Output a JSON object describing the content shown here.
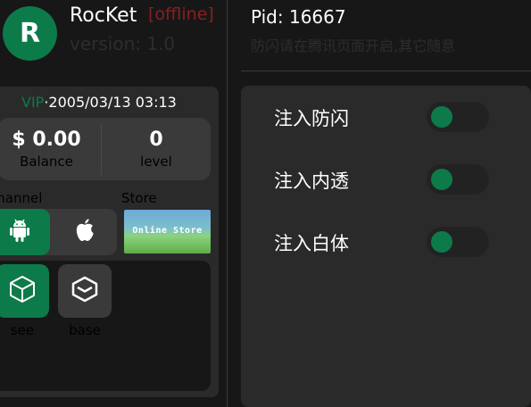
{
  "app": {
    "avatar_letter": "R",
    "name": "RocKet",
    "status": "[offline]",
    "version": "version: 1.0"
  },
  "account": {
    "vip_label": "VIP",
    "separator": "·",
    "date": "2005/03/13  03:13",
    "balance_value": "$ 0.00",
    "balance_label": "Balance",
    "level_value": "0",
    "level_label": "level"
  },
  "channel": {
    "label": "channel",
    "options": [
      {
        "name": "android",
        "icon": "android-icon",
        "active": true
      },
      {
        "name": "apple",
        "icon": "apple-icon",
        "active": false
      }
    ]
  },
  "store": {
    "label": "Store",
    "banner_text": "Online Store"
  },
  "tools": [
    {
      "label": "see",
      "icon": "cube-icon",
      "active": true
    },
    {
      "label": "base",
      "icon": "layers-icon",
      "active": false
    }
  ],
  "process": {
    "pid": "Pid: 16667",
    "hint": "防闪请在腾讯页面开启,其它随意"
  },
  "options": [
    {
      "label": "注入防闪",
      "enabled": false
    },
    {
      "label": "注入内透",
      "enabled": false
    },
    {
      "label": "注入白体",
      "enabled": false
    }
  ],
  "colors": {
    "accent": "#0d7a4a",
    "status_offline": "#8a1f1f",
    "panel": "#2a2a2a",
    "background": "#171717"
  }
}
